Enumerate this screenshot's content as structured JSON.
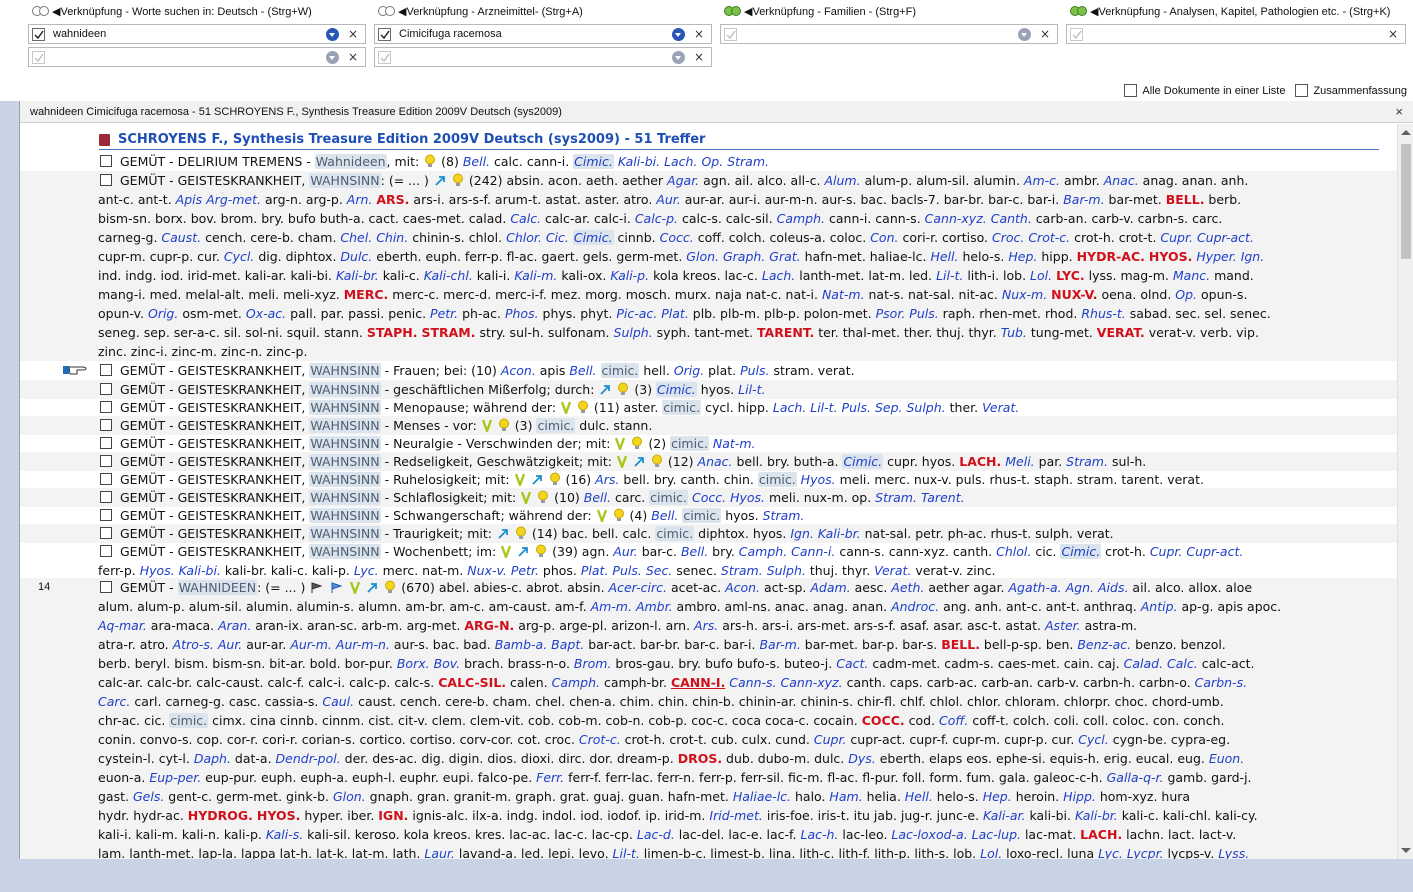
{
  "search": {
    "col1": {
      "title": "◀Verknüpfung - Worte suchen in:  Deutsch - (Strg+W)",
      "value1": "wahnideen",
      "value2": ""
    },
    "col2": {
      "title": "◀Verknüpfung - Arzneimittel- (Strg+A)",
      "value1": "Cimicifuga racemosa",
      "value2": ""
    },
    "col3": {
      "title": "◀Verknüpfung - Familien - (Strg+F)",
      "value1": ""
    },
    "col4": {
      "title": "◀Verknüpfung - Analysen, Kapitel, Pathologien etc. - (Strg+K)",
      "value1": ""
    },
    "clear_glyph": "×",
    "option_all_docs": "Alle Dokumente in einer Liste",
    "option_summary": "Zusammenfassung"
  },
  "results": {
    "title_bar": "wahnideen Cimicifuga racemosa - 51   SCHROYENS F., Synthesis Treasure Edition 2009V Deutsch (sys2009)",
    "close_glyph": "×",
    "source_heading": "SCHROYENS F., Synthesis Treasure Edition 2009V Deutsch (sys2009) - 51 Treffer",
    "line_number_14": "14"
  },
  "colors": {
    "remedy_blue": "#2040c8",
    "remedy_red": "#d0101a",
    "heading_blue": "#1f4fb5",
    "highlight_bg": "#dbe3ec"
  },
  "icons": [
    "checkbox-icon",
    "lightbulb-icon",
    "arrow-icon",
    "v-grade-icon",
    "hand-pointer-icon",
    "book-icon",
    "flag-icon"
  ]
}
